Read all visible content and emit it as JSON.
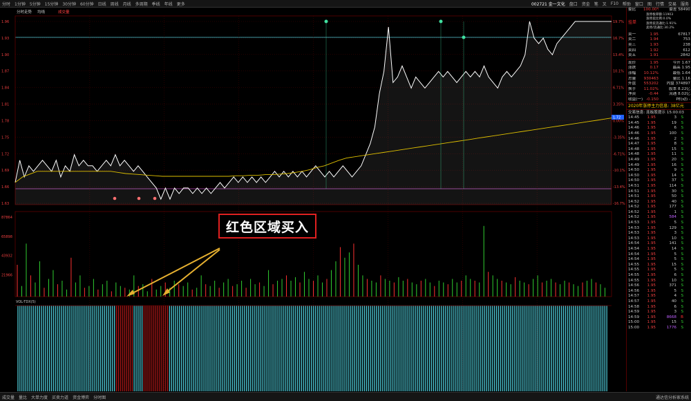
{
  "top_menu": [
    "分时",
    "1分钟",
    "5分钟",
    "15分钟",
    "30分钟",
    "60分钟",
    "日线",
    "周线",
    "月线",
    "多周期",
    "季线",
    "年线",
    "更多"
  ],
  "top_right": [
    "盘口",
    "资金",
    "笔",
    "叉",
    "F10",
    "帮助",
    "窗口",
    "图",
    "行情",
    "交易",
    "服务"
  ],
  "stock_header": {
    "code": "002721",
    "name": "金一文化"
  },
  "chart": {
    "tabs": [
      "分时走势",
      "均线",
      "成交量"
    ],
    "indicator_label": "VOL-TDX(5)",
    "price_axis_left": [
      "1.96",
      "1.93",
      "1.90",
      "1.87",
      "1.84",
      "1.81",
      "1.78",
      "1.75",
      "1.72",
      "1.69",
      "1.66",
      "1.63"
    ],
    "pct_axis_right": [
      "19.7%",
      "16.7%",
      "13.4%",
      "10.1%",
      "6.71%",
      "3.35%",
      "0.00%",
      "-3.35%",
      "-6.71%",
      "-10.1%",
      "-13.4%",
      "-16.7%"
    ],
    "vol_axis_left": [
      "87864",
      "65898",
      "43932",
      "21966"
    ],
    "time_labels": [
      "09:30",
      "10:30",
      "11:30",
      "14:00",
      "15:00"
    ],
    "last_price_tag": "1.72",
    "price_series": [
      1.67,
      1.71,
      1.68,
      1.7,
      1.69,
      1.7,
      1.71,
      1.7,
      1.69,
      1.71,
      1.68,
      1.7,
      1.69,
      1.72,
      1.7,
      1.71,
      1.7,
      1.7,
      1.69,
      1.7,
      1.71,
      1.7,
      1.72,
      1.7,
      1.71,
      1.7,
      1.69,
      1.7,
      1.69,
      1.68,
      1.67,
      1.66,
      1.64,
      1.66,
      1.64,
      1.66,
      1.65,
      1.66,
      1.66,
      1.65,
      1.66,
      1.65,
      1.66,
      1.65,
      1.66,
      1.67,
      1.66,
      1.67,
      1.68,
      1.67,
      1.68,
      1.67,
      1.68,
      1.67,
      1.68,
      1.67,
      1.68,
      1.69,
      1.68,
      1.69,
      1.68,
      1.69,
      1.68,
      1.69,
      1.68,
      1.69,
      1.7,
      1.69,
      1.68,
      1.69,
      1.68,
      1.69,
      1.7,
      1.69,
      1.68,
      1.69,
      1.7,
      1.72,
      1.74,
      1.77,
      1.83,
      1.87,
      1.95,
      1.85,
      1.86,
      1.88,
      1.86,
      1.84,
      1.86,
      1.85,
      1.84,
      1.85,
      1.86,
      1.87,
      1.86,
      1.87,
      1.86,
      1.85,
      1.86,
      1.87,
      1.86,
      1.87,
      1.86,
      1.88,
      1.86,
      1.85,
      1.84,
      1.86,
      1.87,
      1.86,
      1.87,
      1.88,
      1.9,
      1.96,
      1.93,
      1.92,
      1.93,
      1.91,
      1.9,
      1.92,
      1.93,
      1.94,
      1.95,
      1.96,
      1.96,
      1.96,
      1.96,
      1.96,
      1.96,
      1.96,
      1.96,
      1.96
    ],
    "avg_series": [
      1.67,
      1.68,
      1.685,
      1.69,
      1.69,
      1.69,
      1.69,
      1.69,
      1.69,
      1.69,
      1.69,
      1.69,
      1.69,
      1.69,
      1.688,
      1.686,
      1.685,
      1.684,
      1.683,
      1.682,
      1.681,
      1.681,
      1.681,
      1.681,
      1.681,
      1.681,
      1.681,
      1.681,
      1.681,
      1.681,
      1.682,
      1.682,
      1.683,
      1.683,
      1.684,
      1.684,
      1.685,
      1.686,
      1.688,
      1.69,
      1.693,
      1.697,
      1.7,
      1.705,
      1.71,
      1.714,
      1.716,
      1.718,
      1.72,
      1.722,
      1.724,
      1.726,
      1.728,
      1.73,
      1.732,
      1.734,
      1.736,
      1.738,
      1.74,
      1.742,
      1.744,
      1.746,
      1.748,
      1.75,
      1.752,
      1.754,
      1.756,
      1.758,
      1.76,
      1.762,
      1.764,
      1.766,
      1.768,
      1.77,
      1.772,
      1.774,
      1.776,
      1.778,
      1.78,
      1.782,
      1.784,
      1.786
    ],
    "volume_bars": [
      18,
      6,
      30,
      12,
      8,
      20,
      5,
      10,
      15,
      7,
      9,
      4,
      22,
      8,
      12,
      5,
      6,
      10,
      4,
      7,
      9,
      3,
      8,
      6,
      5,
      4,
      12,
      6,
      7,
      3,
      10,
      4,
      6,
      8,
      5,
      9,
      7,
      6,
      8,
      4,
      5,
      12,
      7,
      6,
      9,
      5,
      8,
      10,
      6,
      7,
      9,
      5,
      10,
      7,
      8,
      6,
      15,
      7,
      9,
      10,
      12,
      9,
      11,
      8,
      14,
      10,
      9,
      12,
      8,
      10,
      15,
      20,
      28,
      22,
      25,
      30,
      18,
      12,
      10,
      9,
      8,
      12,
      10,
      9,
      8,
      11,
      9,
      10,
      8,
      7,
      9,
      10,
      8,
      6,
      9,
      8,
      7,
      10,
      8,
      9,
      12,
      10,
      9,
      8,
      40,
      14,
      12,
      10,
      9,
      8,
      7,
      11,
      9,
      8,
      7,
      10,
      12,
      8,
      9,
      10,
      8,
      7,
      9,
      8,
      7,
      6,
      8,
      9,
      10,
      8,
      7,
      5
    ],
    "dot_markers": [
      "top-spike-1",
      "top-spike-2",
      "top-spike-3"
    ]
  },
  "annotation": {
    "text": "红色区域买入"
  },
  "right_panel": {
    "header_title": "委比",
    "header_value": "100.00%",
    "header_diff": "委差",
    "header_diff_value": "58490",
    "order_label": "挂单",
    "order_info": [
      "涨停板单额:11903",
      "涨停卖比例:0.0%",
      "涨停卖流通比:1.91%",
      "卖停/流通比:30.2%"
    ],
    "asks": [
      {
        "label": "卖一",
        "price": "1.95",
        "vol": "67817"
      },
      {
        "label": "卖二",
        "price": "1.94",
        "vol": "753"
      },
      {
        "label": "卖三",
        "price": "1.93",
        "vol": "238"
      },
      {
        "label": "卖四",
        "price": "1.92",
        "vol": "612"
      },
      {
        "label": "卖五",
        "price": "1.91",
        "vol": "2842"
      }
    ],
    "stats": [
      {
        "label": "现价",
        "price": "1.95",
        "vol": "今开 1.67"
      },
      {
        "label": "涨跌",
        "price": "0.17",
        "vol": "最高 1.95"
      },
      {
        "label": "涨幅",
        "price": "10.12%",
        "vol": "最低 1.64"
      },
      {
        "label": "总量",
        "price": "930463",
        "vol": "量比 1.16"
      },
      {
        "label": "外盘",
        "price": "553202",
        "vol": "内盘 374897"
      },
      {
        "label": "换手",
        "price": "11.02%",
        "vol": "股本 8.22亿"
      },
      {
        "label": "净资",
        "price": "-0.44",
        "vol": "流通 8.02亿"
      },
      {
        "label": "收益(一)",
        "price": "-0.150",
        "vol": "PE(动) -"
      }
    ],
    "section_title": "2020年涨停主力信息: 38亿元",
    "section_sub": "交易信息: 连板股提示 15:00:03",
    "ticks": [
      {
        "t": "14:45",
        "p": "1.95",
        "v": "3",
        "s": "S"
      },
      {
        "t": "14:45",
        "p": "1.95",
        "v": "19",
        "s": "S"
      },
      {
        "t": "14:46",
        "p": "1.95",
        "v": "6",
        "s": "S"
      },
      {
        "t": "14:46",
        "p": "1.95",
        "v": "100",
        "s": "S"
      },
      {
        "t": "14:46",
        "p": "1.95",
        "v": "2",
        "s": "S"
      },
      {
        "t": "14:47",
        "p": "1.95",
        "v": "8",
        "s": "S"
      },
      {
        "t": "14:48",
        "p": "1.95",
        "v": "15",
        "s": "S"
      },
      {
        "t": "14:48",
        "p": "1.95",
        "v": "11",
        "s": "S"
      },
      {
        "t": "14:49",
        "p": "1.95",
        "v": "20",
        "s": "S"
      },
      {
        "t": "14:49",
        "p": "1.95",
        "v": "16",
        "s": "S"
      },
      {
        "t": "14:50",
        "p": "1.95",
        "v": "9",
        "s": "S"
      },
      {
        "t": "14:50",
        "p": "1.95",
        "v": "14",
        "s": "S"
      },
      {
        "t": "14:50",
        "p": "1.95",
        "v": "37",
        "s": "S"
      },
      {
        "t": "14:51",
        "p": "1.95",
        "v": "114",
        "s": "S"
      },
      {
        "t": "14:51",
        "p": "1.95",
        "v": "30",
        "s": "S"
      },
      {
        "t": "14:51",
        "p": "1.95",
        "v": "50",
        "s": "S"
      },
      {
        "t": "14:52",
        "p": "1.95",
        "v": "40",
        "s": "S"
      },
      {
        "t": "14:52",
        "p": "1.95",
        "v": "177",
        "s": "S"
      },
      {
        "t": "14:52",
        "p": "1.95",
        "v": "1",
        "s": "S"
      },
      {
        "t": "14:52",
        "p": "1.95",
        "v": "584",
        "s": "S"
      },
      {
        "t": "14:53",
        "p": "1.95",
        "v": "5",
        "s": "S"
      },
      {
        "t": "14:53",
        "p": "1.95",
        "v": "129",
        "s": "S"
      },
      {
        "t": "14:53",
        "p": "1.95",
        "v": "3",
        "s": "S"
      },
      {
        "t": "14:53",
        "p": "1.95",
        "v": "10",
        "s": "S"
      },
      {
        "t": "14:54",
        "p": "1.95",
        "v": "141",
        "s": "S"
      },
      {
        "t": "14:54",
        "p": "1.95",
        "v": "14",
        "s": "S"
      },
      {
        "t": "14:54",
        "p": "1.95",
        "v": "5",
        "s": "S"
      },
      {
        "t": "14:54",
        "p": "1.95",
        "v": "5",
        "s": "S"
      },
      {
        "t": "14:55",
        "p": "1.95",
        "v": "15",
        "s": "S"
      },
      {
        "t": "14:55",
        "p": "1.95",
        "v": "5",
        "s": "S"
      },
      {
        "t": "14:55",
        "p": "1.95",
        "v": "6",
        "s": "S"
      },
      {
        "t": "14:55",
        "p": "1.95",
        "v": "10",
        "s": "S"
      },
      {
        "t": "14:56",
        "p": "1.95",
        "v": "371",
        "s": "S"
      },
      {
        "t": "14:56",
        "p": "1.95",
        "v": "5",
        "s": "S"
      },
      {
        "t": "14:57",
        "p": "1.95",
        "v": "4",
        "s": "S"
      },
      {
        "t": "14:57",
        "p": "1.95",
        "v": "40",
        "s": "S"
      },
      {
        "t": "14:58",
        "p": "1.95",
        "v": "6",
        "s": "S"
      },
      {
        "t": "14:59",
        "p": "1.95",
        "v": "3",
        "s": "S"
      },
      {
        "t": "14:59",
        "p": "1.95",
        "v": "8668",
        "s": "B"
      },
      {
        "t": "15:00",
        "p": "1.95",
        "v": "15",
        "s": "S"
      },
      {
        "t": "15:00",
        "p": "1.95",
        "v": "1776",
        "s": "S"
      }
    ]
  },
  "bottom_tabs": [
    "成交量",
    "量比",
    "大单力度",
    "买卖力道",
    "资金博弈",
    "分时图"
  ],
  "bottom_right": "通达信分析家系统",
  "colors": {
    "price_line": "#ffffff",
    "avg_line": "#e0c000",
    "up": "#ff3030",
    "down": "#30d030",
    "buy_zone": "#b01818",
    "cyan_bars": "#4ecbd8",
    "grid": "#500000"
  }
}
